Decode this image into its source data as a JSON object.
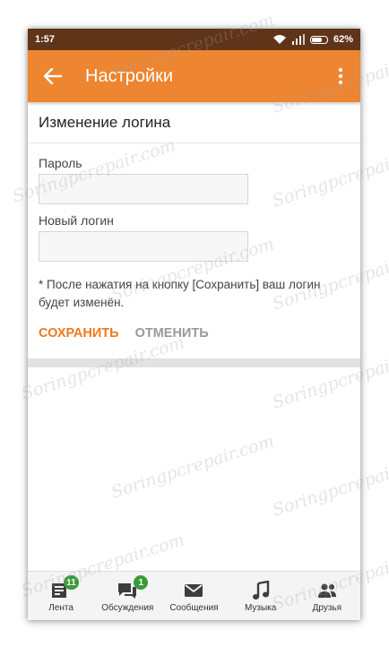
{
  "status": {
    "time": "1:57",
    "battery": "62%"
  },
  "appbar": {
    "title": "Настройки"
  },
  "page": {
    "section_title": "Изменение логина",
    "password_label": "Пароль",
    "password_value": "",
    "new_login_label": "Новый логин",
    "new_login_value": "",
    "note": "* После нажатия на кнопку [Сохранить] ваш логин будет изменён.",
    "save_label": "СОХРАНИТЬ",
    "cancel_label": "ОТМЕНИТЬ"
  },
  "nav": [
    {
      "label": "Лента",
      "badge": "11",
      "icon": "feed-icon"
    },
    {
      "label": "Обсуждения",
      "badge": "1",
      "icon": "discussions-icon"
    },
    {
      "label": "Сообщения",
      "badge": "",
      "icon": "mail-icon"
    },
    {
      "label": "Музыка",
      "badge": "",
      "icon": "music-icon"
    },
    {
      "label": "Друзья",
      "badge": "",
      "icon": "friends-icon"
    }
  ],
  "watermark": "Soringpcrepair.com",
  "colors": {
    "accent": "#ee8530",
    "statusbar": "#5f3418",
    "badge": "#3a9b3a"
  }
}
